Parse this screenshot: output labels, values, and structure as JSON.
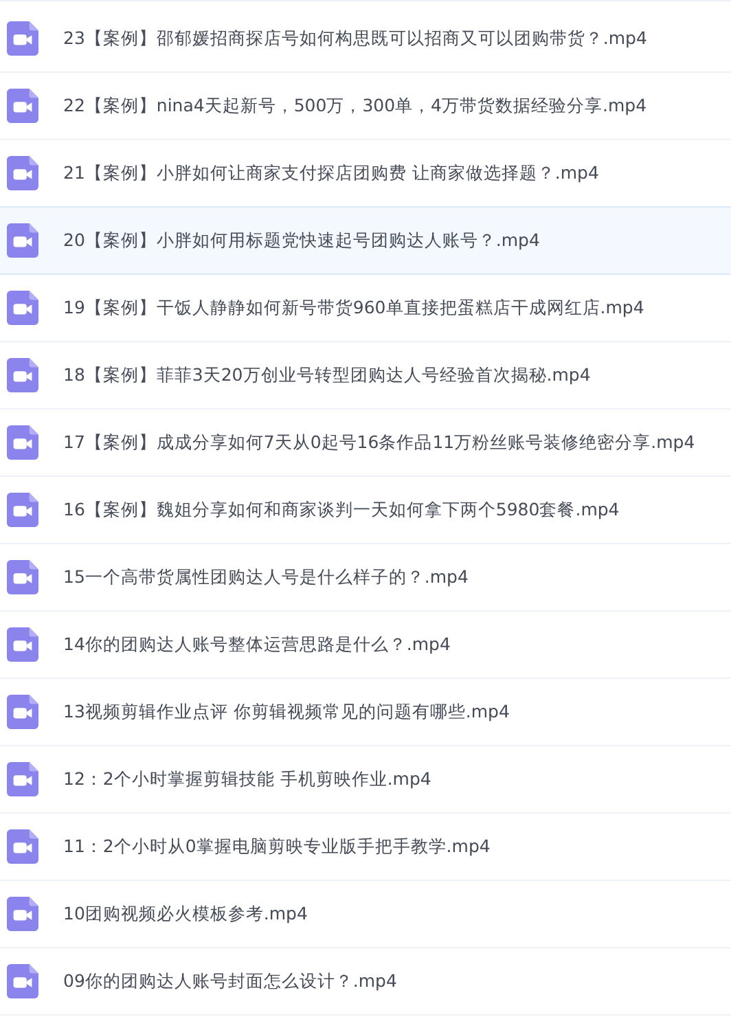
{
  "files": [
    {
      "name": "23【案例】邵郁媛招商探店号如何构思既可以招商又可以团购带货？.mp4",
      "selected": false
    },
    {
      "name": "22【案例】nina4天起新号，500万，300单，4万带货数据经验分享.mp4",
      "selected": false
    },
    {
      "name": "21【案例】小胖如何让商家支付探店团购费 让商家做选择题？.mp4",
      "selected": false
    },
    {
      "name": "20【案例】小胖如何用标题党快速起号团购达人账号？.mp4",
      "selected": true
    },
    {
      "name": "19【案例】干饭人静静如何新号带货960单直接把蛋糕店干成网红店.mp4",
      "selected": false
    },
    {
      "name": "18【案例】菲菲3天20万创业号转型团购达人号经验首次揭秘.mp4",
      "selected": false
    },
    {
      "name": "17【案例】成成分享如何7天从0起号16条作品11万粉丝账号装修绝密分享.mp4",
      "selected": false
    },
    {
      "name": "16【案例】魏姐分享如何和商家谈判一天如何拿下两个5980套餐.mp4",
      "selected": false
    },
    {
      "name": "15一个高带货属性团购达人号是什么样子的？.mp4",
      "selected": false
    },
    {
      "name": "14你的团购达人账号整体运营思路是什么？.mp4",
      "selected": false
    },
    {
      "name": "13视频剪辑作业点评 你剪辑视频常见的问题有哪些.mp4",
      "selected": false
    },
    {
      "name": "12：2个小时掌握剪辑技能 手机剪映作业.mp4",
      "selected": false
    },
    {
      "name": "11：2个小时从0掌握电脑剪映专业版手把手教学.mp4",
      "selected": false
    },
    {
      "name": "10团购视频必火模板参考.mp4",
      "selected": false
    },
    {
      "name": "09你的团购达人账号封面怎么设计？.mp4",
      "selected": false
    }
  ]
}
